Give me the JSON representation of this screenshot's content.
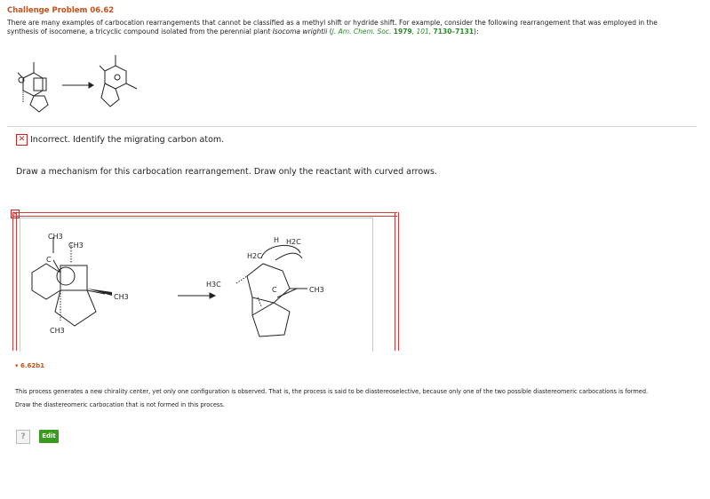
{
  "header": {
    "title": "Challenge Problem 06.62",
    "intro_part1": "There are many examples of carbocation rearrangements that cannot be classified as a methyl shift or hydride shift. For example, consider the following rearrangement that was employed in the synthesis of isocomene, a tricyclic compound isolated from the perennial plant ",
    "plant": "Isocoma wrightii",
    "intro_part2": " (",
    "journal": "J. Am. Chem. Soc.",
    "year": "1979",
    "volume": "101",
    "pages": "7130–7131",
    "intro_part3": "):"
  },
  "feedback": {
    "icon": "✕",
    "text": "Incorrect. Identify the migrating carbon atom."
  },
  "prompt": "Draw a mechanism for this carbocation rearrangement. Draw only the reactant with curved arrows.",
  "drawing": {
    "mark": "✕",
    "labels": {
      "ch3_top": "CH3",
      "ch3_second": "CH3",
      "c_plus": "C",
      "ch3_right": "CH3",
      "ch3_bottom": "CH3",
      "h3c_left": "H3C",
      "h2c": "H2C",
      "h": "H",
      "h2c_top": "H2C",
      "ch3_prod": "CH3",
      "c_center": "C"
    }
  },
  "hint": "▾ 6.62b1",
  "para1": "This process generates a new chirality center, yet only one configuration is observed. That is, the process is said to be diastereoselective, because only one of the two possible diastereomeric carbocations is formed.",
  "para2": "Draw the diastereomeric carbocation that is not formed in this process.",
  "buttons": {
    "help": "?",
    "edit": "Edit"
  },
  "colors": {
    "title": "#c8501a",
    "reference": "#2a8a2a",
    "error": "#cc2222",
    "edit": "#3a9a1e"
  }
}
